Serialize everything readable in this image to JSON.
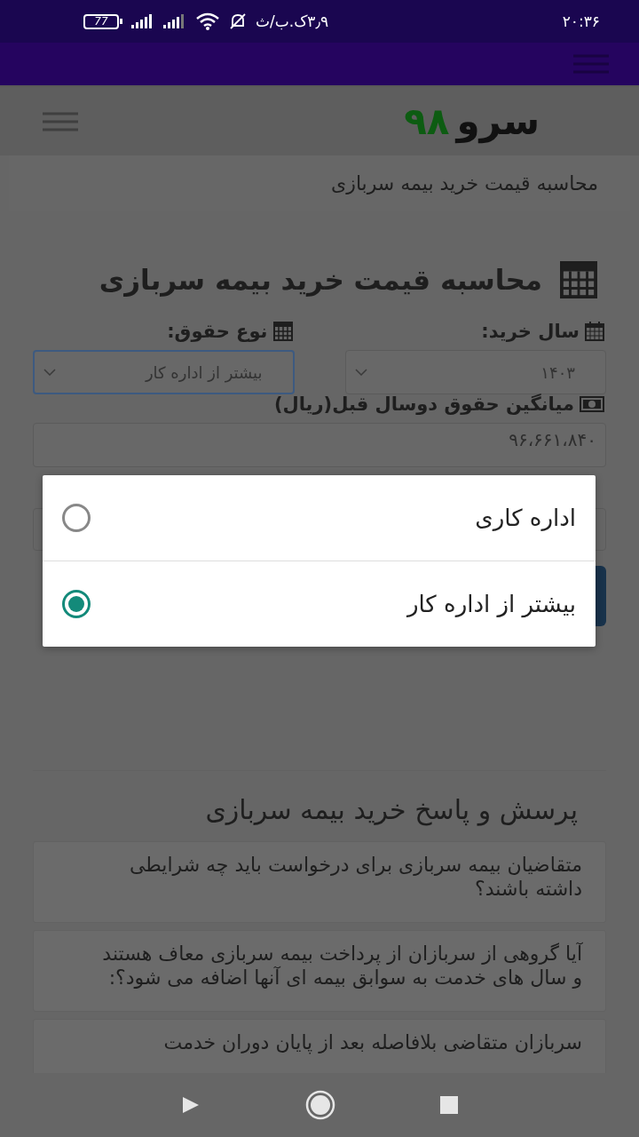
{
  "status_bar": {
    "time": "۲۰:۳۶",
    "network_speed": "۳٫۹ک.ب/ث",
    "battery": "77"
  },
  "site": {
    "logo_name": "سرو",
    "logo_number": "۹۸"
  },
  "breadcrumb": "محاسبه قیمت خرید بیمه سربازی",
  "calculator": {
    "title": "محاسبه قیمت خرید بیمه سربازی",
    "fields": [
      {
        "label": "سال خرید:",
        "kind": "select",
        "value": "۱۴۰۳",
        "focused": false
      },
      {
        "label": "نوع حقوق:",
        "kind": "select",
        "value": "بیشتر از اداره کار",
        "focused": true
      },
      {
        "label": "میانگین حقوق دوسال قبل(ریال)",
        "kind": "input",
        "value": "۹۶،۶۶۱،۸۴۰",
        "focused": false
      }
    ]
  },
  "dialog": {
    "options": [
      {
        "label": "اداره کاری",
        "selected": false
      },
      {
        "label": "بیشتر از اداره کار",
        "selected": true
      }
    ]
  },
  "faq": {
    "title": "پرسش و پاسخ خرید بیمه سربازی",
    "items": [
      "متقاضیان بیمه سربازی برای درخواست باید چه شرایطی داشته باشند؟",
      "آیا گروهی از سربازان از پرداخت بیمه سربازی معاف هستند و سال های خدمت به سوابق بیمه ای آنها اضافه می شود؟:",
      "سربازان متقاضی بلافاصله بعد از پایان دوران خدمت"
    ]
  }
}
